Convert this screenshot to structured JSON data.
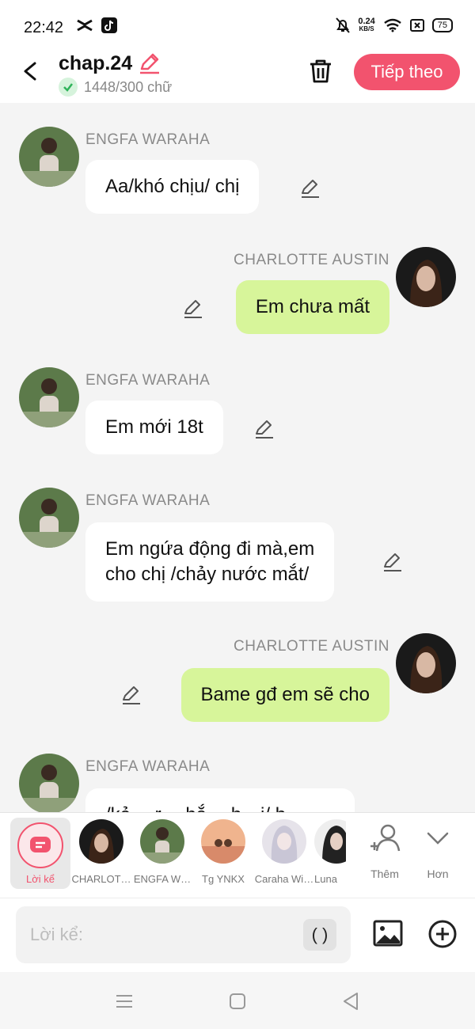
{
  "status": {
    "time": "22:42",
    "net_speed_value": "0.24",
    "net_speed_unit": "KB/S",
    "battery": "75",
    "icons": [
      "capcut-icon",
      "tiktok-icon",
      "bell-off-icon",
      "wifi-icon",
      "x-box-icon",
      "battery-icon"
    ]
  },
  "header": {
    "title": "chap.24",
    "word_count": "1448/300 chữ",
    "next_label": "Tiếp theo",
    "accent_color": "#f2536e"
  },
  "messages": [
    {
      "side": "left",
      "name": "ENGFA WARAHA",
      "text": "Aa/khó chịu/ chị"
    },
    {
      "side": "right",
      "name": "CHARLOTTE AUSTIN",
      "text": "Em chưa mất"
    },
    {
      "side": "left",
      "name": "ENGFA WARAHA",
      "text": "Em mới 18t"
    },
    {
      "side": "left",
      "name": "ENGFA WARAHA",
      "text_line1": "Em ngứa động đi mà,em",
      "text_line2": "cho chị /chảy nước mắt/"
    },
    {
      "side": "right",
      "name": "CHARLOTTE AUSTIN",
      "text": "Bame gđ em sẽ cho"
    },
    {
      "side": "left",
      "name": "ENGFA WARAHA",
      "text": "/kẻ… r… hắ… h…i/ b…"
    }
  ],
  "characters": {
    "narrator_label": "Lời kể",
    "items": [
      {
        "label": "CHARLOT…"
      },
      {
        "label": "ENGFA W…"
      },
      {
        "label": "Tg YNKX"
      },
      {
        "label": "Caraha Wi…"
      },
      {
        "label": "Luna"
      }
    ],
    "add_label": "Thêm",
    "more_label": "Hơn"
  },
  "input": {
    "placeholder": "Lời kể:",
    "paren_label": "( )"
  }
}
